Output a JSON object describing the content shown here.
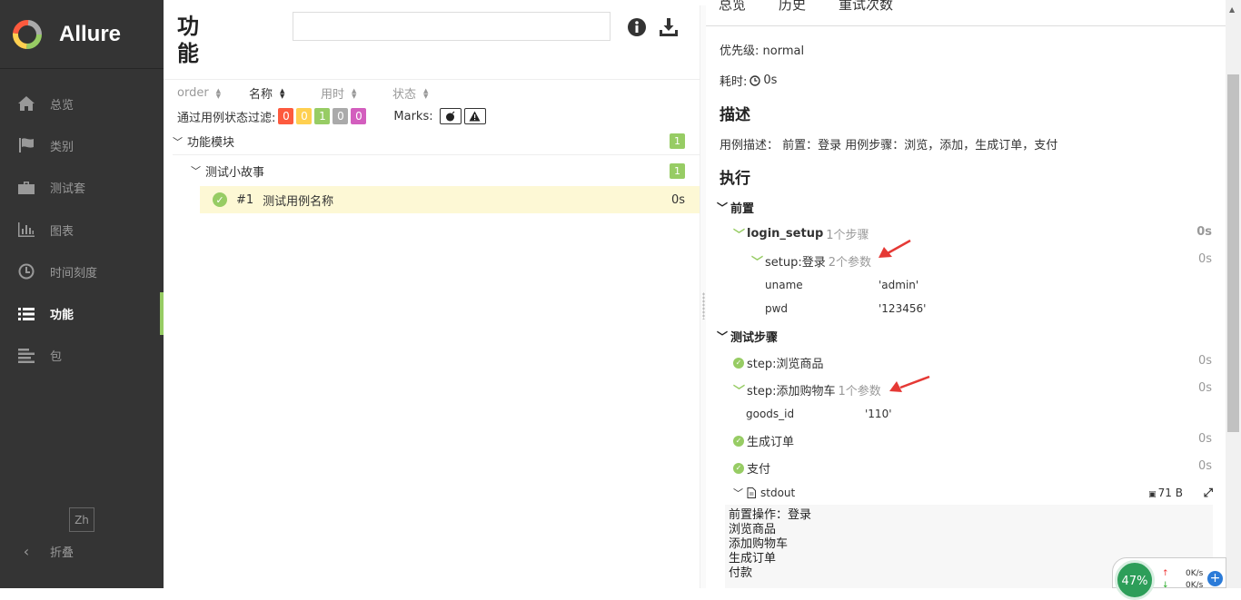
{
  "brand": {
    "name": "Allure"
  },
  "sidebar": {
    "items": [
      {
        "label": "总览",
        "icon": "home-icon"
      },
      {
        "label": "类别",
        "icon": "flag-icon"
      },
      {
        "label": "测试套",
        "icon": "briefcase-icon"
      },
      {
        "label": "图表",
        "icon": "bar-chart-icon"
      },
      {
        "label": "时间刻度",
        "icon": "clock-icon"
      },
      {
        "label": "功能",
        "icon": "list-icon",
        "active": true
      },
      {
        "label": "包",
        "icon": "align-left-icon"
      }
    ],
    "lang": "Zh",
    "collapse": "折叠"
  },
  "middle": {
    "title": "功能",
    "search": {
      "value": "",
      "placeholder": ""
    },
    "sort": [
      "order",
      "名称",
      "用时",
      "状态"
    ],
    "sort_active": "名称",
    "filter_label": "通过用例状态过滤:",
    "filter_badges": [
      {
        "value": "0",
        "color": "#fd5a3e"
      },
      {
        "value": "0",
        "color": "#ffd050"
      },
      {
        "value": "1",
        "color": "#97cc64"
      },
      {
        "value": "0",
        "color": "#aaaaaa"
      },
      {
        "value": "0",
        "color": "#d35ebe"
      }
    ],
    "marks_label": "Marks:",
    "tree": {
      "feature": {
        "label": "功能模块",
        "count": "1"
      },
      "story": {
        "label": "测试小故事",
        "count": "1"
      },
      "case": {
        "number": "#1",
        "name": "测试用例名称",
        "duration": "0s"
      }
    }
  },
  "right": {
    "tabs": [
      "总览",
      "历史",
      "重试次数"
    ],
    "priority": "优先级: normal",
    "duration_label": "耗时:",
    "duration_value": "0s",
    "desc_heading": "描述",
    "desc_text": "用例描述： 前置：登录 用例步骤：浏览，添加，生成订单，支付",
    "exec_heading": "执行",
    "setup_heading": "前置",
    "login_setup": {
      "name": "login_setup",
      "meta": "1个步骤",
      "duration": "0s"
    },
    "setup_step": {
      "name": "setup:登录",
      "meta": "2个参数",
      "duration": "0s"
    },
    "setup_params": [
      {
        "name": "uname",
        "value": "'admin'"
      },
      {
        "name": "pwd",
        "value": "'123456'"
      }
    ],
    "steps_heading": "测试步骤",
    "step_browse": {
      "name": "step:浏览商品",
      "duration": "0s"
    },
    "step_add": {
      "name": "step:添加购物车",
      "meta": "1个参数",
      "duration": "0s"
    },
    "step_add_param": {
      "name": "goods_id",
      "value": "'110'"
    },
    "step_order": {
      "name": "生成订单",
      "duration": "0s"
    },
    "step_pay": {
      "name": "支付",
      "duration": "0s"
    },
    "attachment": {
      "name": "stdout",
      "size": "71 B"
    },
    "stdout_lines": [
      "前置操作：登录",
      "浏览商品",
      "添加购物车",
      "生成订单",
      "付款"
    ]
  },
  "net_widget": {
    "percent": "47%",
    "up": "0K/s",
    "down": "0K/s"
  },
  "colors": {
    "sidebar_bg": "#343434",
    "passed": "#97cc64",
    "highlight": "#fdf8d5",
    "annotation_arrow": "#e53935"
  }
}
